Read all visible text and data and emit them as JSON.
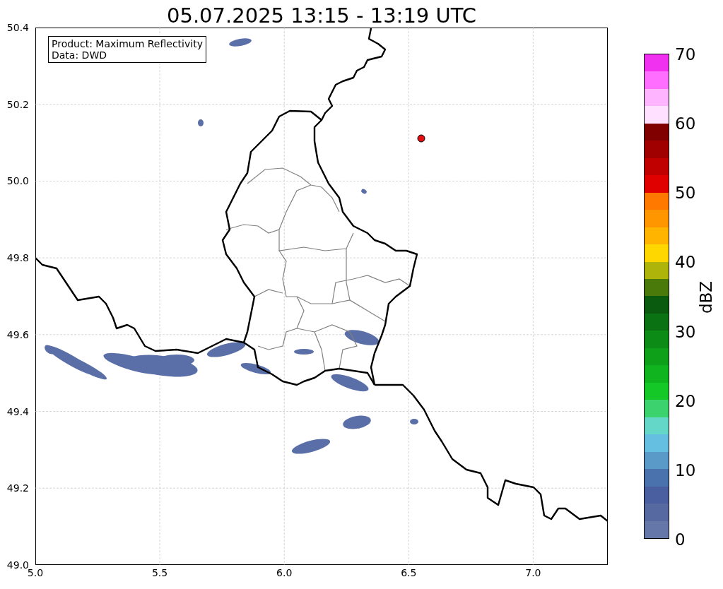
{
  "title": "05.07.2025 13:15 - 13:19 UTC",
  "info_box": [
    "Product: Maximum Reflectivity",
    "Data: DWD"
  ],
  "x_ticks": [
    "5.0",
    "5.5",
    "6.0",
    "6.5",
    "7.0"
  ],
  "y_ticks": [
    "50.4",
    "50.2",
    "50.0",
    "49.8",
    "49.6",
    "49.4",
    "49.2",
    "49.0"
  ],
  "colorbar": {
    "label": "dBZ",
    "ticks": [
      "70",
      "60",
      "50",
      "40",
      "30",
      "20",
      "10",
      "0"
    ],
    "segments": [
      {
        "color": "#6477a8"
      },
      {
        "color": "#5669a0"
      },
      {
        "color": "#4a5fa0"
      },
      {
        "color": "#4a73ad"
      },
      {
        "color": "#5a9ac8"
      },
      {
        "color": "#64bfe0"
      },
      {
        "color": "#64d7c8"
      },
      {
        "color": "#3cd26e"
      },
      {
        "color": "#14c828"
      },
      {
        "color": "#10b41e"
      },
      {
        "color": "#0fa01a"
      },
      {
        "color": "#0c8c16"
      },
      {
        "color": "#0a7212"
      },
      {
        "color": "#0a5a10"
      },
      {
        "color": "#4a7a0a"
      },
      {
        "color": "#afb40a"
      },
      {
        "color": "#ffd700"
      },
      {
        "color": "#ffb400"
      },
      {
        "color": "#ff9600"
      },
      {
        "color": "#ff7800"
      },
      {
        "color": "#e10000"
      },
      {
        "color": "#c00000"
      },
      {
        "color": "#a00000"
      },
      {
        "color": "#800000"
      },
      {
        "color": "#ffe1ff"
      },
      {
        "color": "#ffb4ff"
      },
      {
        "color": "#ff6eff"
      },
      {
        "color": "#f032f0"
      }
    ]
  }
}
